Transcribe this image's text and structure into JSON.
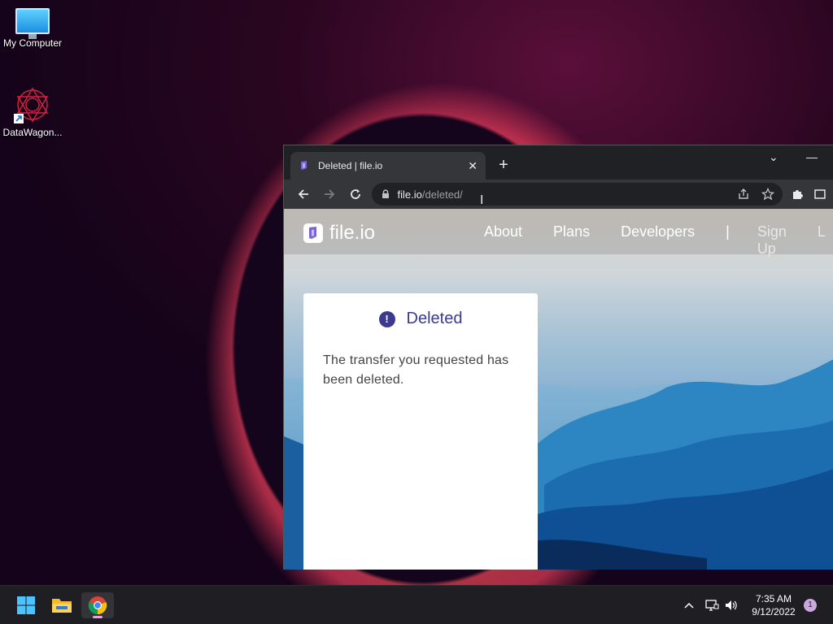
{
  "desktop": {
    "icons": [
      {
        "label": "My Computer",
        "icon": "monitor-icon"
      },
      {
        "label": "DataWagon...",
        "icon": "datawagon-icon"
      }
    ]
  },
  "browser": {
    "tab": {
      "title": "Deleted | file.io",
      "close": "✕"
    },
    "new_tab": "+",
    "window_controls": {
      "dropdown": "⌄",
      "minimize": "—"
    },
    "address": {
      "host": "file.io",
      "path": "/deleted/"
    },
    "colors": {
      "frame": "#202124",
      "toolbar": "#35363a",
      "accent": "#3b3a8f"
    }
  },
  "site": {
    "logo_text": "file.io",
    "nav": {
      "about": "About",
      "plans": "Plans",
      "developers": "Developers",
      "separator": "|",
      "signup": "Sign Up",
      "login_partial": "L"
    },
    "card": {
      "title": "Deleted",
      "message": "The transfer you requested has been deleted."
    }
  },
  "taskbar": {
    "clock_time": "7:35 AM",
    "clock_date": "9/12/2022",
    "notification_count": "1"
  }
}
